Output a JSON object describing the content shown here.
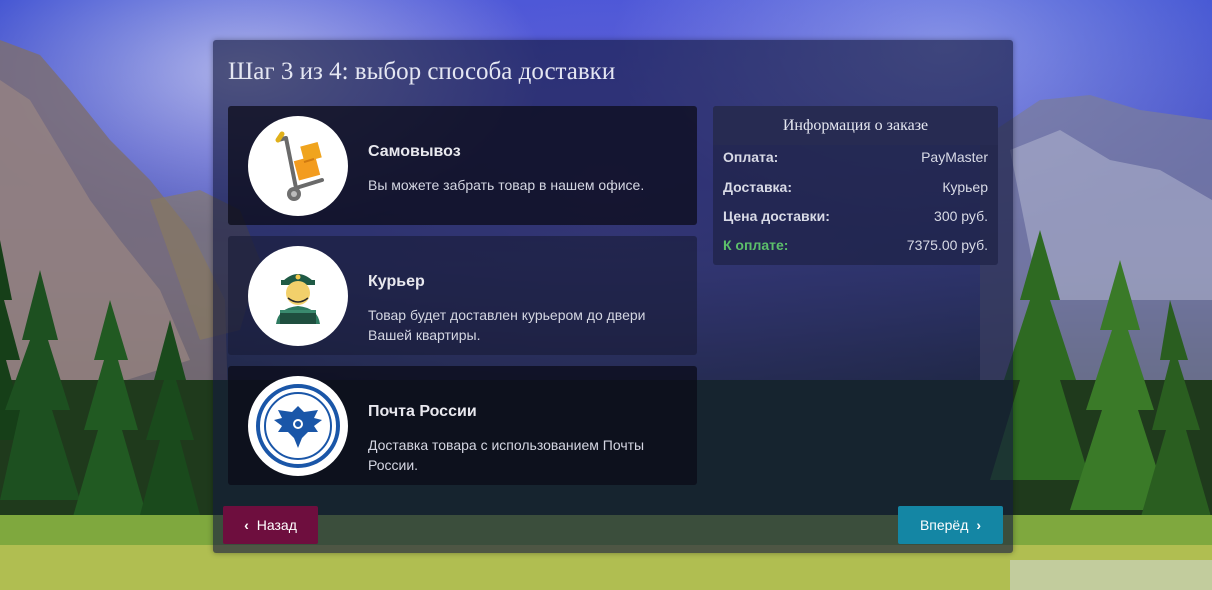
{
  "page": {
    "title": "Шаг 3 из 4: выбор способа доставки"
  },
  "options": [
    {
      "title": "Самовывоз",
      "desc": "Вы можете забрать товар в нашем офисе.",
      "icon": "hand-truck-icon"
    },
    {
      "title": "Курьер",
      "desc": "Товар будет доставлен курьером до двери Вашей квартиры.",
      "icon": "courier-icon"
    },
    {
      "title": "Почта России",
      "desc": "Доставка товара с использованием Почты России.",
      "icon": "russian-post-logo-icon"
    }
  ],
  "order": {
    "heading": "Информация о заказе",
    "rows": [
      {
        "label": "Оплата:",
        "value": "PayMaster"
      },
      {
        "label": "Доставка:",
        "value": "Курьер"
      },
      {
        "label": "Цена доставки:",
        "value": "300 руб."
      },
      {
        "label": "К оплате:",
        "value": "7375.00 руб."
      }
    ]
  },
  "buttons": {
    "back": "Назад",
    "next": "Вперёд"
  },
  "colors": {
    "back_button": "#6e0e3e",
    "next_button": "#1486a4",
    "total_label": "#5cc06a"
  }
}
